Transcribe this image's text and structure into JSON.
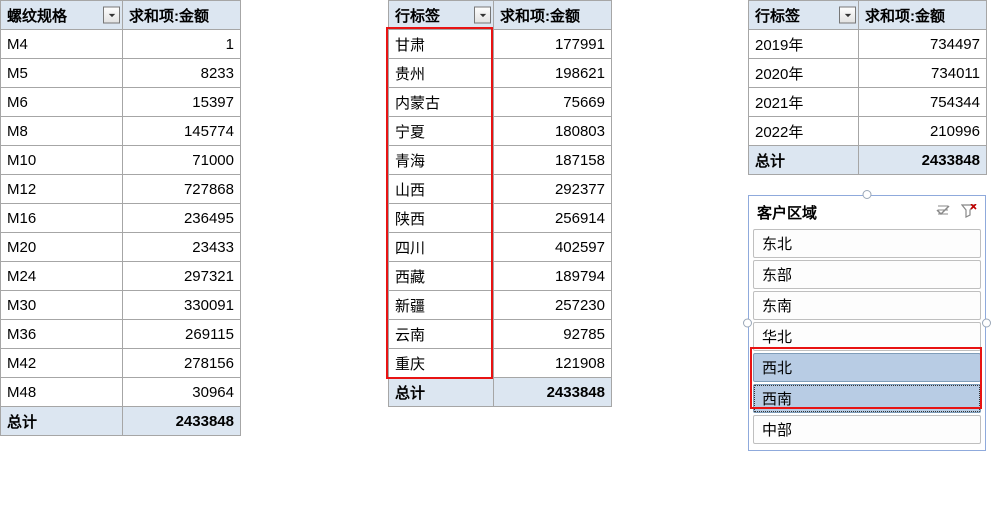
{
  "pivot1": {
    "headers": [
      "螺纹规格",
      "求和项:金额"
    ],
    "rows": [
      {
        "label": "M4",
        "value": "1"
      },
      {
        "label": "M5",
        "value": "8233"
      },
      {
        "label": "M6",
        "value": "15397"
      },
      {
        "label": "M8",
        "value": "145774"
      },
      {
        "label": "M10",
        "value": "71000"
      },
      {
        "label": "M12",
        "value": "727868"
      },
      {
        "label": "M16",
        "value": "236495"
      },
      {
        "label": "M20",
        "value": "23433"
      },
      {
        "label": "M24",
        "value": "297321"
      },
      {
        "label": "M30",
        "value": "330091"
      },
      {
        "label": "M36",
        "value": "269115"
      },
      {
        "label": "M42",
        "value": "278156"
      },
      {
        "label": "M48",
        "value": "30964"
      }
    ],
    "total_label": "总计",
    "total_value": "2433848"
  },
  "pivot2": {
    "headers": [
      "行标签",
      "求和项:金额"
    ],
    "rows": [
      {
        "label": "甘肃",
        "value": "177991"
      },
      {
        "label": "贵州",
        "value": "198621"
      },
      {
        "label": "内蒙古",
        "value": "75669"
      },
      {
        "label": "宁夏",
        "value": "180803"
      },
      {
        "label": "青海",
        "value": "187158"
      },
      {
        "label": "山西",
        "value": "292377"
      },
      {
        "label": "陕西",
        "value": "256914"
      },
      {
        "label": "四川",
        "value": "402597"
      },
      {
        "label": "西藏",
        "value": "189794"
      },
      {
        "label": "新疆",
        "value": "257230"
      },
      {
        "label": "云南",
        "value": "92785"
      },
      {
        "label": "重庆",
        "value": "121908"
      }
    ],
    "total_label": "总计",
    "total_value": "2433848"
  },
  "pivot3": {
    "headers": [
      "行标签",
      "求和项:金额"
    ],
    "rows": [
      {
        "label": "2019年",
        "value": "734497"
      },
      {
        "label": "2020年",
        "value": "734011"
      },
      {
        "label": "2021年",
        "value": "754344"
      },
      {
        "label": "2022年",
        "value": "210996"
      }
    ],
    "total_label": "总计",
    "total_value": "2433848"
  },
  "slicer": {
    "title": "客户区域",
    "items": [
      {
        "label": "东北",
        "selected": false
      },
      {
        "label": "东部",
        "selected": false
      },
      {
        "label": "东南",
        "selected": false
      },
      {
        "label": "华北",
        "selected": false
      },
      {
        "label": "西北",
        "selected": true
      },
      {
        "label": "西南",
        "selected": true
      },
      {
        "label": "中部",
        "selected": false
      }
    ],
    "icons": {
      "multi": "multi-select-icon",
      "clear": "clear-filter-icon"
    }
  }
}
